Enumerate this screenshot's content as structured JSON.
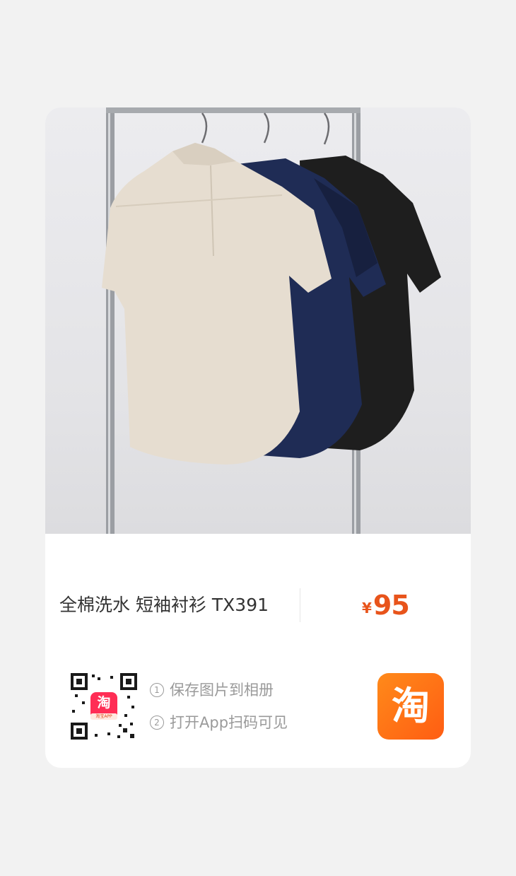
{
  "product": {
    "title": "全棉洗水 短袖衬衫 TX391",
    "currency": "¥",
    "price": "95"
  },
  "share": {
    "steps": [
      {
        "num": "1",
        "text": "保存图片到相册"
      },
      {
        "num": "2",
        "text": "打开App扫码可见"
      }
    ],
    "qr_center_badge": "淘",
    "qr_center_sub": "淘宝APP",
    "app_button_glyph": "淘"
  },
  "colors": {
    "price": "#e8541b",
    "taobao_orange": "#ff5d13",
    "shirt_cream": "#e6ddd0",
    "shirt_navy": "#1f2c55",
    "shirt_black": "#1e1e1e"
  }
}
